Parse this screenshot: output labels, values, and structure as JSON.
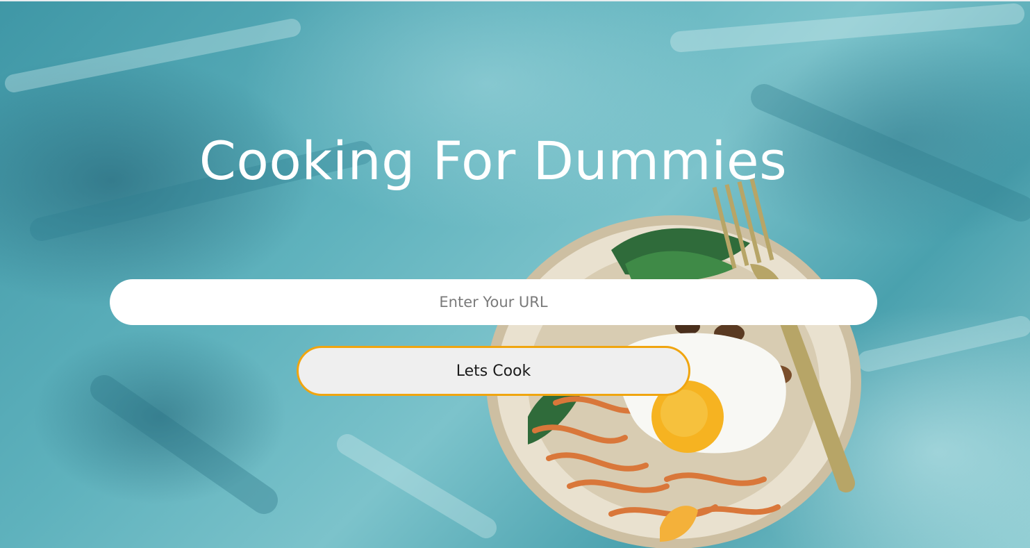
{
  "page": {
    "title": "Cooking For Dummies"
  },
  "form": {
    "url_placeholder": "Enter Your URL",
    "url_value": "",
    "submit_label": "Lets Cook"
  },
  "colors": {
    "background": "#5fb2bd",
    "title_text": "#ffffff",
    "input_background": "#ffffff",
    "button_background": "#efefef",
    "button_border": "#f0a50f"
  },
  "images": {
    "background": "painted-teal-texture-with-food-bowl-image"
  }
}
